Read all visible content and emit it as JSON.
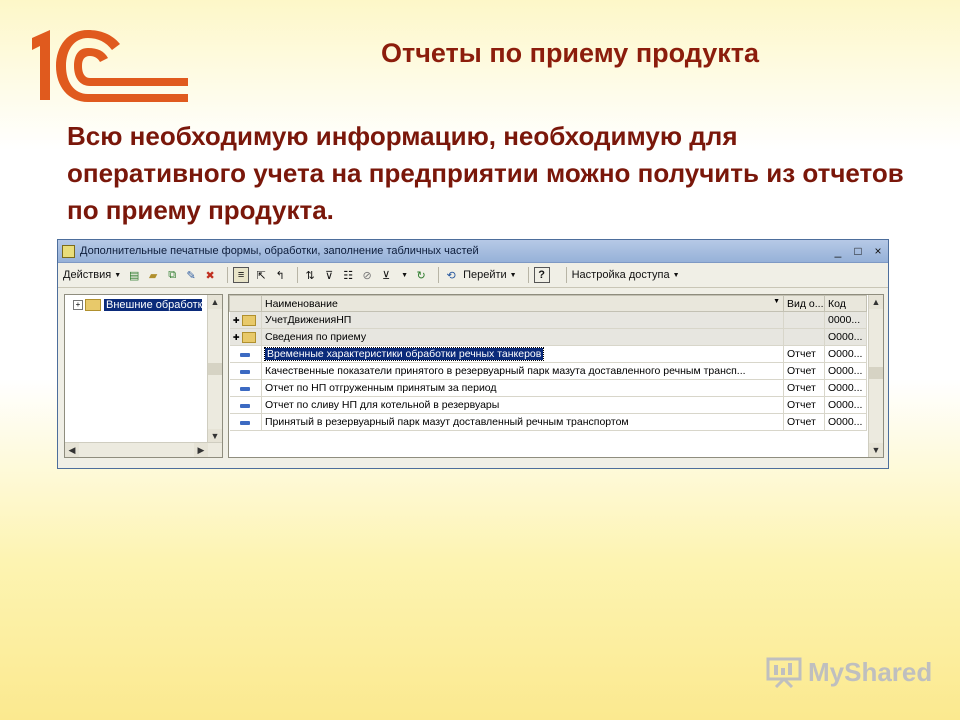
{
  "slide": {
    "title": "Отчеты по приему продукта",
    "text": "Всю необходимую информацию, необходимую для оперативного учета на предприятии можно получить из отчетов по приему продукта."
  },
  "colors": {
    "accent": "#8c1d0c",
    "logo": "#e05a1e",
    "selection": "#0a2a7a"
  },
  "window": {
    "title": "Дополнительные печатные формы, обработки, заполнение табличных частей",
    "controls": [
      "_",
      "□",
      "×"
    ],
    "toolbar": {
      "actions": "Действия",
      "goto": "Перейти",
      "help": "?",
      "access": "Настройка доступа"
    },
    "tree": {
      "item": "Внешние обработки"
    },
    "grid": {
      "columns": [
        "Наименование",
        "Вид о...",
        "Код"
      ],
      "rows": [
        {
          "kind": "group",
          "name": "УчетДвиженияНП",
          "type": "",
          "code": "0000..."
        },
        {
          "kind": "group",
          "name": "Сведения по приему",
          "type": "",
          "code": "О000..."
        },
        {
          "kind": "item",
          "name": "Временные характеристики обработки речных танкеров",
          "type": "Отчет",
          "code": "О000...",
          "selected": true
        },
        {
          "kind": "item",
          "name": "Качественные показатели принятого в резервуарный парк мазута доставленного речным трансп...",
          "type": "Отчет",
          "code": "О000..."
        },
        {
          "kind": "item",
          "name": "Отчет по НП отгруженным принятым за период",
          "type": "Отчет",
          "code": "О000..."
        },
        {
          "kind": "item",
          "name": "Отчет по сливу НП для котельной в резервуары",
          "type": "Отчет",
          "code": "О000..."
        },
        {
          "kind": "item",
          "name": "Принятый в резервуарный парк мазут доставленный речным транспортом",
          "type": "Отчет",
          "code": "О000..."
        }
      ]
    }
  },
  "watermark": {
    "text": "MyShared"
  }
}
